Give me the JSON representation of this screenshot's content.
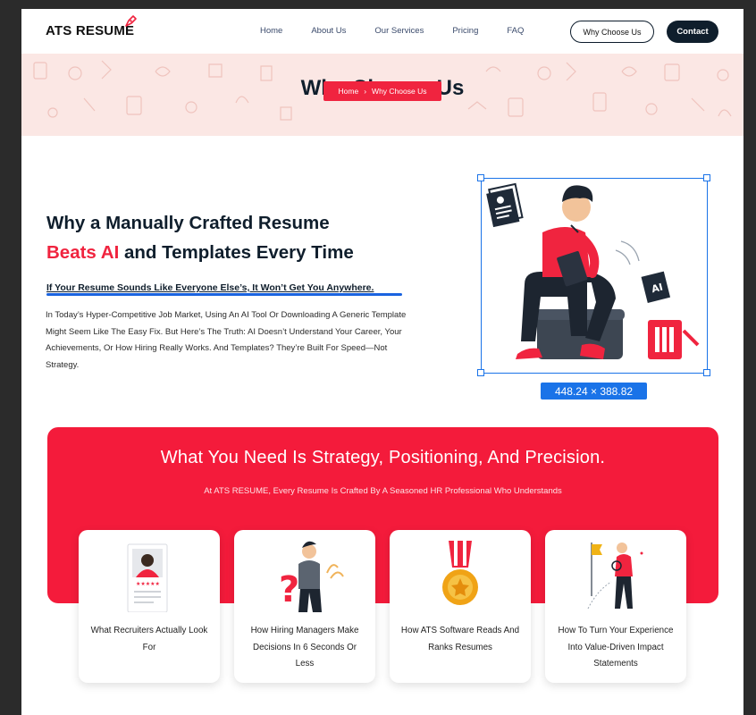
{
  "header": {
    "logo": "ATS RESUME",
    "nav": [
      "Home",
      "About Us",
      "Our Services",
      "Pricing",
      "FAQ"
    ],
    "cta_outline": "Why Choose Us",
    "cta_dark": "Contact"
  },
  "hero": {
    "title": "Why Choose Us",
    "breadcrumb_home": "Home",
    "breadcrumb_sep": "›",
    "breadcrumb_current": "Why Choose Us"
  },
  "intro": {
    "heading_line1": "Why a Manually Crafted Resume",
    "heading_red": "Beats AI",
    "heading_rest": "and Templates Every Time",
    "subheading": "If Your Resume Sounds Like Everyone Else’s, It Won’t Get You Anywhere.",
    "paragraph": "In Today’s Hyper-Competitive Job Market, Using An AI Tool Or Downloading A Generic Template Might Seem Like The Easy Fix. But Here’s The Truth: AI Doesn’t Understand Your Career, Your Achievements, Or How Hiring Really Works. And Templates? They’re Built For Speed—Not Strategy.",
    "image_dimensions": "448.24 × 388.82",
    "ai_badge": "AI"
  },
  "strategy": {
    "title": "What You Need Is Strategy, Positioning, And Precision.",
    "subtitle": "At ATS RESUME, Every Resume Is Crafted By A Seasoned HR Professional Who Understands",
    "cards": [
      {
        "label": "What Recruiters Actually Look For",
        "icon": "resume-profile-icon"
      },
      {
        "label": "How Hiring Managers Make Decisions In 6 Seconds Or Less",
        "icon": "thinking-man-icon"
      },
      {
        "label": "How ATS Software Reads And Ranks Resumes",
        "icon": "medal-icon"
      },
      {
        "label": "How To Turn Your Experience Into Value-Driven Impact Statements",
        "icon": "goal-flag-icon"
      }
    ]
  },
  "colors": {
    "brand_red": "#f41b3b",
    "navy": "#0f1e2c",
    "selection_blue": "#1a73e8",
    "hero_bg": "#fbe7e4"
  }
}
